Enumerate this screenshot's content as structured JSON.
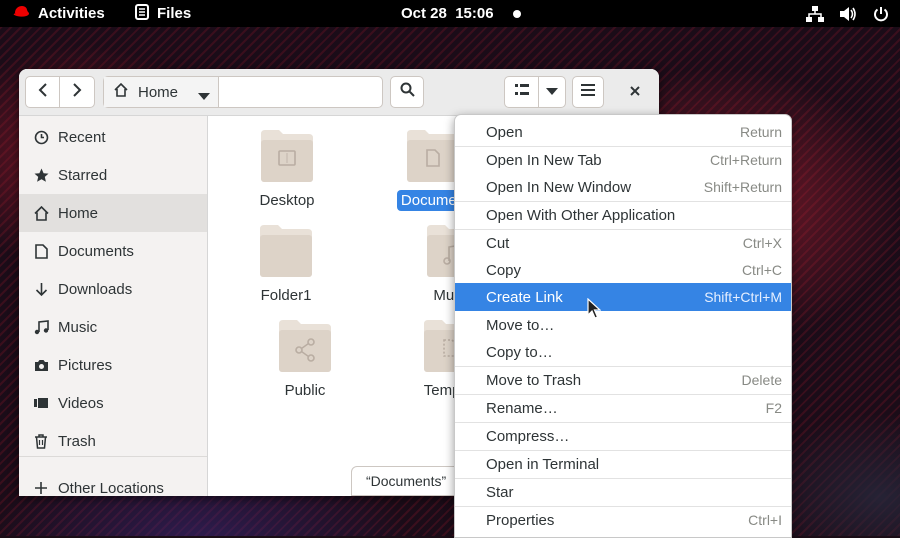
{
  "topbar": {
    "activities": "Activities",
    "app_name": "Files",
    "clock": "Oct 28  15:06"
  },
  "window": {
    "path": {
      "home_label": "Home"
    }
  },
  "sidebar": {
    "items": [
      {
        "label": "Recent",
        "icon": "clock-icon"
      },
      {
        "label": "Starred",
        "icon": "star-icon"
      },
      {
        "label": "Home",
        "icon": "home-icon",
        "active": true
      },
      {
        "label": "Documents",
        "icon": "document-icon"
      },
      {
        "label": "Downloads",
        "icon": "download-icon"
      },
      {
        "label": "Music",
        "icon": "music-icon"
      },
      {
        "label": "Pictures",
        "icon": "camera-icon"
      },
      {
        "label": "Videos",
        "icon": "video-icon"
      },
      {
        "label": "Trash",
        "icon": "trash-icon"
      },
      {
        "label": "Other Locations",
        "icon": "plus-icon"
      }
    ]
  },
  "files": [
    {
      "name": "Desktop",
      "icon": "folder-desktop-icon"
    },
    {
      "name": "Documen",
      "icon": "folder-documents-icon",
      "selected": true
    },
    {
      "name": "Folder1",
      "icon": "folder-icon"
    },
    {
      "name": "Music",
      "icon": "folder-music-icon"
    },
    {
      "name": "Public",
      "icon": "folder-share-icon"
    },
    {
      "name": "Templat",
      "icon": "folder-templates-icon"
    }
  ],
  "status_overlay": "“Documents”",
  "context_menu": {
    "items": [
      {
        "label": "Open",
        "accel": "Return"
      },
      {
        "label": "Open In New Tab",
        "accel": "Ctrl+Return"
      },
      {
        "label": "Open In New Window",
        "accel": "Shift+Return"
      },
      {
        "label": "Open With Other Application",
        "accel": ""
      },
      {
        "label": "Cut",
        "accel": "Ctrl+X"
      },
      {
        "label": "Copy",
        "accel": "Ctrl+C"
      },
      {
        "label": "Create Link",
        "accel": "Shift+Ctrl+M",
        "highlighted": true
      },
      {
        "label": "Move to…",
        "accel": ""
      },
      {
        "label": "Copy to…",
        "accel": ""
      },
      {
        "label": "Move to Trash",
        "accel": "Delete"
      },
      {
        "label": "Rename…",
        "accel": "F2"
      },
      {
        "label": "Compress…",
        "accel": ""
      },
      {
        "label": "Open in Terminal",
        "accel": ""
      },
      {
        "label": "Star",
        "accel": ""
      },
      {
        "label": "Properties",
        "accel": "Ctrl+I"
      }
    ]
  },
  "colors": {
    "accent": "#3584e4",
    "topbar": "#000000",
    "folder": "#e9e1d8"
  }
}
